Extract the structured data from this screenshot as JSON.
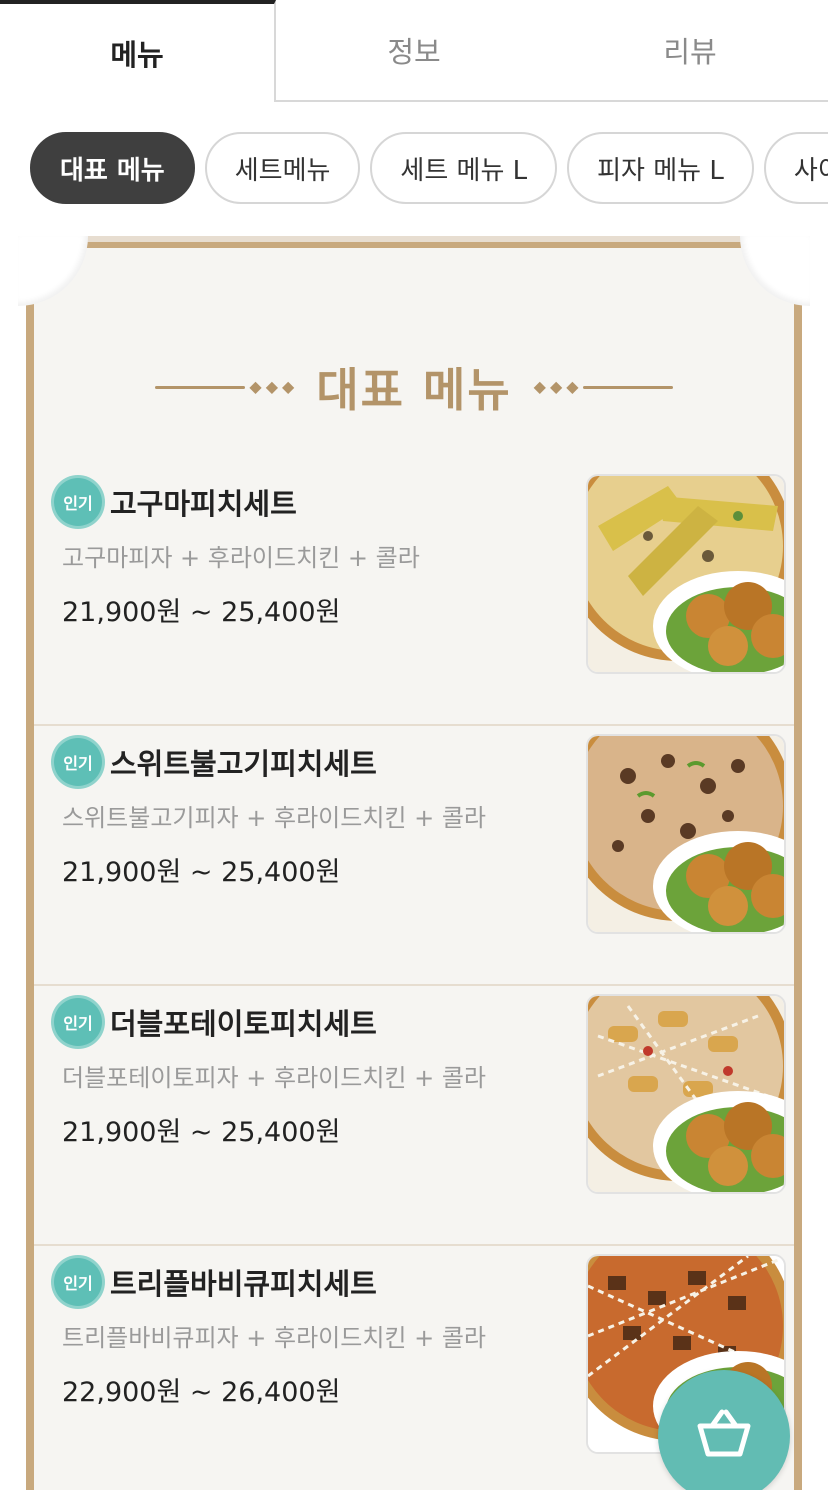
{
  "tabs": [
    {
      "label": "메뉴",
      "active": true
    },
    {
      "label": "정보",
      "active": false
    },
    {
      "label": "리뷰",
      "active": false
    }
  ],
  "categories": [
    {
      "label": "대표 메뉴",
      "active": true
    },
    {
      "label": "세트메뉴",
      "active": false
    },
    {
      "label": "세트 메뉴 L",
      "active": false
    },
    {
      "label": "피자 메뉴 L",
      "active": false
    },
    {
      "label": "사이",
      "active": false
    }
  ],
  "section_title": "대표 메뉴",
  "badge_label": "인기",
  "items": [
    {
      "name": "고구마피치세트",
      "desc": "고구마피자 + 후라이드치킨 + 콜라",
      "price": "21,900원 ~ 25,400원",
      "image": "sweet-potato-pizza-chicken"
    },
    {
      "name": "스위트불고기피치세트",
      "desc": "스위트불고기피자 + 후라이드치킨 + 콜라",
      "price": "21,900원 ~ 25,400원",
      "image": "bulgogi-pizza-chicken"
    },
    {
      "name": "더블포테이토피치세트",
      "desc": "더블포테이토피자 + 후라이드치킨 + 콜라",
      "price": "21,900원 ~ 25,400원",
      "image": "potato-pizza-chicken"
    },
    {
      "name": "트리플바비큐피치세트",
      "desc": "트리플바비큐피자 + 후라이드치킨 + 콜라",
      "price": "22,900원 ~ 26,400원",
      "image": "bbq-pizza-chicken"
    }
  ],
  "colors": {
    "accent": "#5ebfb6",
    "gold": "#b39469",
    "frame": "#c8a97e"
  },
  "cart_icon": "basket-icon"
}
